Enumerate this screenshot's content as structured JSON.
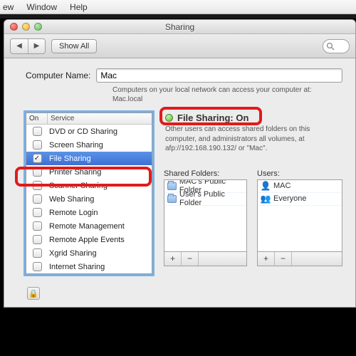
{
  "menubar": {
    "items": [
      "ew",
      "Window",
      "Help"
    ]
  },
  "window": {
    "title": "Sharing",
    "toolbar": {
      "back_glyph": "◀",
      "fwd_glyph": "▶",
      "show_all": "Show All",
      "search_placeholder": ""
    }
  },
  "computer_name": {
    "label": "Computer Name:",
    "value": "Mac",
    "hint_line1": "Computers on your local network can access your computer at:",
    "hint_line2": "Mac.local"
  },
  "services": {
    "col_on": "On",
    "col_service": "Service",
    "items": [
      {
        "label": "DVD or CD Sharing",
        "checked": false,
        "selected": false
      },
      {
        "label": "Screen Sharing",
        "checked": false,
        "selected": false
      },
      {
        "label": "File Sharing",
        "checked": true,
        "selected": true
      },
      {
        "label": "Printer Sharing",
        "checked": false,
        "selected": false
      },
      {
        "label": "Scanner Sharing",
        "checked": false,
        "selected": false
      },
      {
        "label": "Web Sharing",
        "checked": false,
        "selected": false
      },
      {
        "label": "Remote Login",
        "checked": false,
        "selected": false
      },
      {
        "label": "Remote Management",
        "checked": false,
        "selected": false
      },
      {
        "label": "Remote Apple Events",
        "checked": false,
        "selected": false
      },
      {
        "label": "Xgrid Sharing",
        "checked": false,
        "selected": false
      },
      {
        "label": "Internet Sharing",
        "checked": false,
        "selected": false
      }
    ]
  },
  "status": {
    "title": "File Sharing: On",
    "desc": "Other users can access shared folders on this computer, and administrators all volumes, at afp://192.168.190.132/ or \"Mac\"."
  },
  "shared_folders": {
    "label": "Shared Folders:",
    "items": [
      "MAC's Public Folder",
      "User's Public Folder"
    ],
    "plus": "+",
    "minus": "−"
  },
  "users": {
    "label": "Users:",
    "items": [
      {
        "icon": "user",
        "name": "MAC"
      },
      {
        "icon": "group",
        "name": "Everyone"
      }
    ],
    "plus": "+",
    "minus": "−"
  },
  "lock_glyph": "🔒"
}
